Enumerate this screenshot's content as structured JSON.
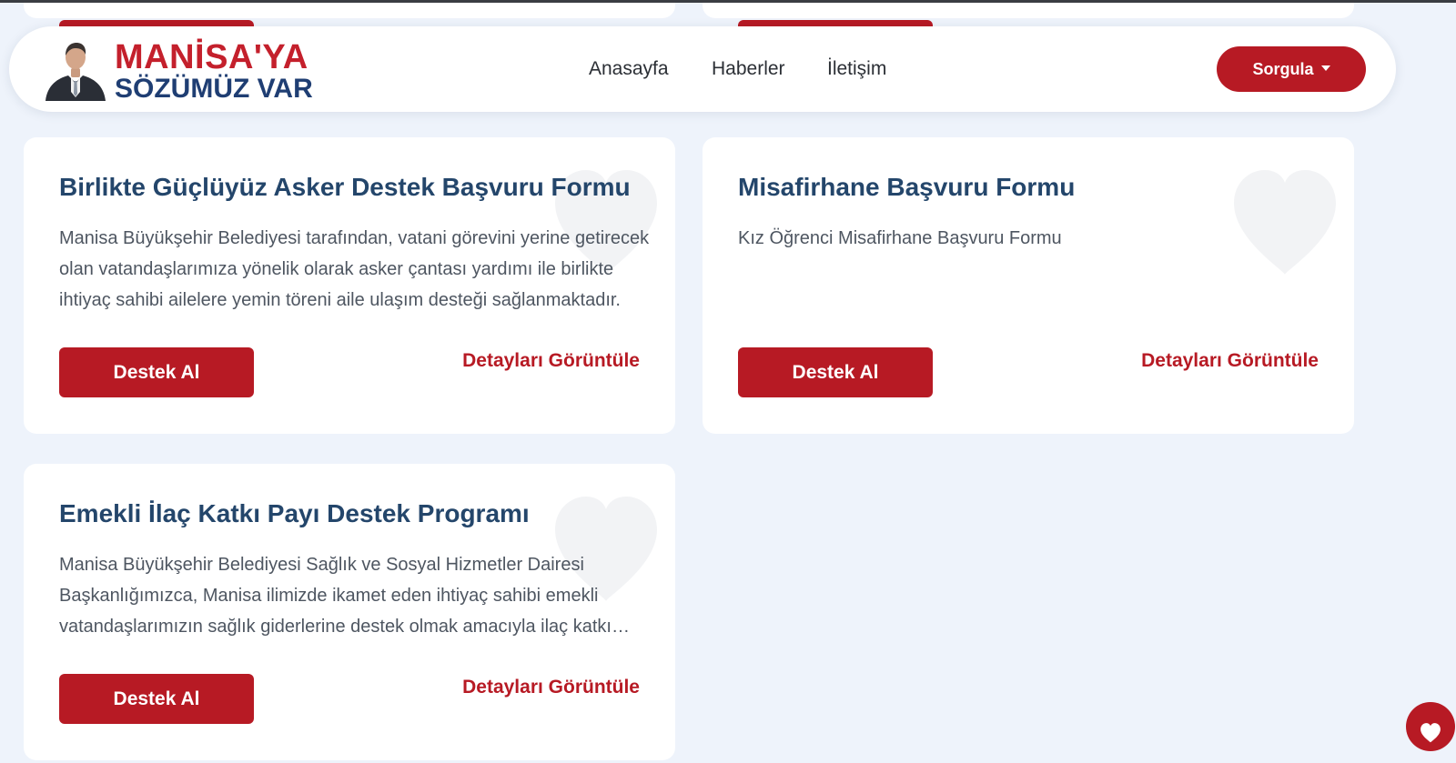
{
  "header": {
    "logo": {
      "line1": "MANİSA'YA",
      "line2": "SÖZÜMÜZ VAR"
    },
    "nav": [
      {
        "label": "Anasayfa"
      },
      {
        "label": "Haberler"
      },
      {
        "label": "İletişim"
      }
    ],
    "query_button": {
      "label": "Sorgula",
      "icon": "caret-down-icon"
    }
  },
  "cards": [
    {
      "title": "Birlikte Güçlüyüz Asker Destek Başvuru Formu",
      "description": "Manisa Büyükşehir Belediyesi tarafından, vatani görevini yerine getirecek olan vatandaşlarımıza yönelik olarak asker çantası yardımı ile birlikte ihtiyaç sahibi ailelere yemin töreni aile ulaşım desteği sağlanmaktadır.",
      "primary_label": "Destek Al",
      "link_label": "Detayları Görüntüle"
    },
    {
      "title": "Misafirhane Başvuru Formu",
      "description": "Kız Öğrenci Misafirhane Başvuru Formu",
      "primary_label": "Destek Al",
      "link_label": "Detayları Görüntüle"
    },
    {
      "title": "Emekli İlaç Katkı Payı Destek Programı",
      "description": "Manisa Büyükşehir Belediyesi Sağlık ve Sosyal Hizmetler Dairesi Başkanlığımızca, Manisa ilimizde ikamet eden ihtiyaç sahibi emekli vatandaşlarımızın sağlık giderlerine destek olmak amacıyla ilaç katkı payı desteği verilmektedir.",
      "primary_label": "Destek Al",
      "link_label": "Detayları Görüntüle"
    }
  ],
  "floating_button": {
    "icon": "heart-icon"
  },
  "colors": {
    "brand_red": "#b71a24",
    "title_navy": "#24466b",
    "logo_navy": "#1f3e73",
    "page_background": "#eef3fb"
  }
}
